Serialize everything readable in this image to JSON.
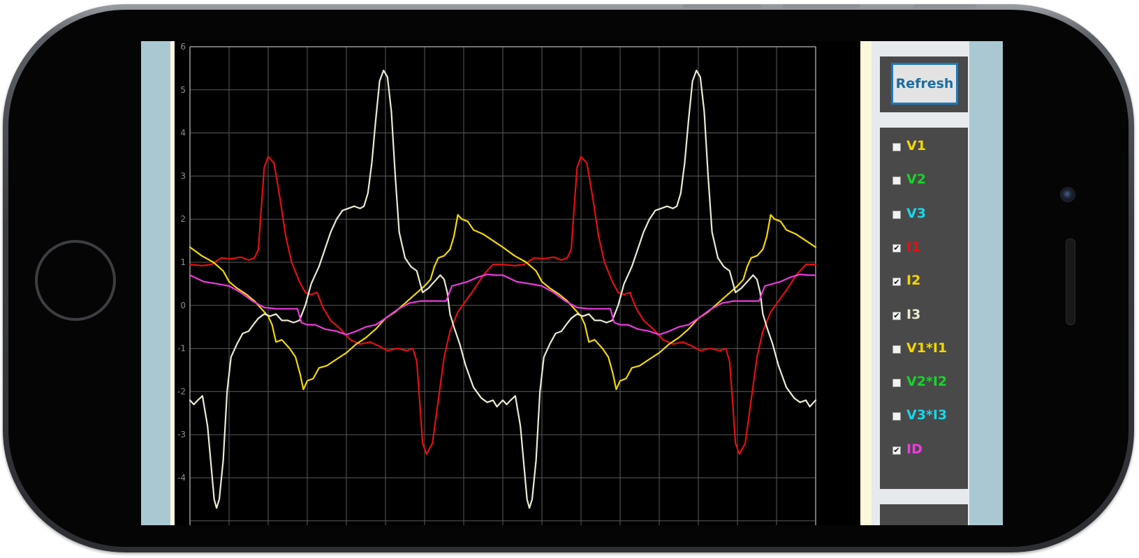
{
  "toolbar": {
    "refresh_label": "Refresh"
  },
  "series_toggles": [
    {
      "label": "V1",
      "checked": false,
      "color": "#f5d800"
    },
    {
      "label": "V2",
      "checked": false,
      "color": "#17d42a"
    },
    {
      "label": "V3",
      "checked": false,
      "color": "#1ad6e8"
    },
    {
      "label": "I1",
      "checked": true,
      "color": "#e51010"
    },
    {
      "label": "I2",
      "checked": true,
      "color": "#f5d800"
    },
    {
      "label": "I3",
      "checked": true,
      "color": "#ecebd2"
    },
    {
      "label": "V1*I1",
      "checked": false,
      "color": "#f5d800"
    },
    {
      "label": "V2*I2",
      "checked": false,
      "color": "#17d42a"
    },
    {
      "label": "V3*I3",
      "checked": false,
      "color": "#1ad6e8"
    },
    {
      "label": "ID",
      "checked": true,
      "color": "#ee3be0"
    }
  ],
  "lower_panel": {
    "partial_text": ""
  },
  "chart_data": {
    "type": "line",
    "title": "",
    "xlabel": "",
    "ylabel": "",
    "ylim": [
      -4.6,
      6
    ],
    "yticks": [
      6,
      5,
      4,
      3,
      2,
      1,
      0,
      -1,
      -2,
      -3,
      -4
    ],
    "grid": true,
    "x_divisions": 16,
    "series": [
      {
        "label_key": "I1",
        "color": "#e51010",
        "points": [
          [
            0.0,
            0.95
          ],
          [
            0.3,
            0.92
          ],
          [
            0.55,
            0.95
          ],
          [
            0.8,
            1.1
          ],
          [
            1.05,
            1.08
          ],
          [
            1.3,
            1.12
          ],
          [
            1.5,
            1.05
          ],
          [
            1.65,
            1.1
          ],
          [
            1.75,
            1.3
          ],
          [
            1.82,
            2.2
          ],
          [
            1.9,
            3.2
          ],
          [
            2.0,
            3.45
          ],
          [
            2.15,
            3.3
          ],
          [
            2.3,
            2.5
          ],
          [
            2.45,
            1.6
          ],
          [
            2.6,
            1.0
          ],
          [
            2.8,
            0.55
          ],
          [
            2.95,
            0.3
          ],
          [
            3.1,
            0.25
          ],
          [
            3.25,
            0.3
          ],
          [
            3.4,
            -0.05
          ],
          [
            3.6,
            -0.35
          ],
          [
            3.85,
            -0.55
          ],
          [
            4.1,
            -0.8
          ],
          [
            4.35,
            -0.9
          ],
          [
            4.6,
            -0.85
          ],
          [
            4.85,
            -0.95
          ],
          [
            5.05,
            -1.05
          ],
          [
            5.3,
            -1.0
          ],
          [
            5.55,
            -1.05
          ],
          [
            5.7,
            -1.0
          ],
          [
            5.8,
            -1.3
          ],
          [
            5.88,
            -2.3
          ],
          [
            5.95,
            -3.2
          ],
          [
            6.05,
            -3.45
          ],
          [
            6.2,
            -3.2
          ],
          [
            6.35,
            -2.2
          ],
          [
            6.5,
            -1.2
          ],
          [
            6.65,
            -0.6
          ],
          [
            6.85,
            -0.15
          ],
          [
            7.05,
            0.1
          ],
          [
            7.25,
            0.35
          ],
          [
            7.5,
            0.7
          ],
          [
            7.75,
            0.95
          ],
          [
            8.0,
            0.95
          ]
        ],
        "repeat_period": 8.0
      },
      {
        "label_key": "I2",
        "color": "#f5d800",
        "points": [
          [
            0.0,
            1.35
          ],
          [
            0.3,
            1.15
          ],
          [
            0.6,
            1.0
          ],
          [
            0.85,
            0.8
          ],
          [
            1.0,
            0.55
          ],
          [
            1.2,
            0.4
          ],
          [
            1.45,
            0.25
          ],
          [
            1.65,
            0.1
          ],
          [
            1.85,
            -0.1
          ],
          [
            2.0,
            -0.25
          ],
          [
            2.1,
            -0.45
          ],
          [
            2.2,
            -0.85
          ],
          [
            2.35,
            -0.8
          ],
          [
            2.55,
            -1.0
          ],
          [
            2.7,
            -1.2
          ],
          [
            2.82,
            -1.6
          ],
          [
            2.9,
            -1.95
          ],
          [
            3.0,
            -1.75
          ],
          [
            3.15,
            -1.7
          ],
          [
            3.3,
            -1.45
          ],
          [
            3.5,
            -1.4
          ],
          [
            3.75,
            -1.25
          ],
          [
            4.0,
            -1.1
          ],
          [
            4.25,
            -0.9
          ],
          [
            4.5,
            -0.75
          ],
          [
            4.75,
            -0.55
          ],
          [
            5.0,
            -0.3
          ],
          [
            5.25,
            -0.15
          ],
          [
            5.5,
            0.05
          ],
          [
            5.75,
            0.25
          ],
          [
            6.0,
            0.45
          ],
          [
            6.15,
            0.6
          ],
          [
            6.25,
            0.9
          ],
          [
            6.35,
            1.1
          ],
          [
            6.5,
            1.15
          ],
          [
            6.65,
            1.3
          ],
          [
            6.75,
            1.6
          ],
          [
            6.85,
            2.1
          ],
          [
            6.95,
            2.0
          ],
          [
            7.1,
            1.95
          ],
          [
            7.25,
            1.75
          ],
          [
            7.5,
            1.65
          ],
          [
            7.75,
            1.5
          ],
          [
            8.0,
            1.35
          ]
        ],
        "repeat_period": 8.0
      },
      {
        "label_key": "I3",
        "color": "#ecebd2",
        "points": [
          [
            0.0,
            -2.2
          ],
          [
            0.1,
            -2.3
          ],
          [
            0.2,
            -2.2
          ],
          [
            0.32,
            -2.1
          ],
          [
            0.45,
            -2.8
          ],
          [
            0.55,
            -3.8
          ],
          [
            0.62,
            -4.5
          ],
          [
            0.68,
            -4.7
          ],
          [
            0.75,
            -4.5
          ],
          [
            0.85,
            -3.6
          ],
          [
            0.95,
            -2.0
          ],
          [
            1.05,
            -1.2
          ],
          [
            1.2,
            -0.9
          ],
          [
            1.35,
            -0.65
          ],
          [
            1.5,
            -0.6
          ],
          [
            1.62,
            -0.45
          ],
          [
            1.75,
            -0.3
          ],
          [
            1.9,
            -0.2
          ],
          [
            2.05,
            -0.25
          ],
          [
            2.2,
            -0.2
          ],
          [
            2.35,
            -0.35
          ],
          [
            2.5,
            -0.35
          ],
          [
            2.65,
            -0.4
          ],
          [
            2.8,
            -0.35
          ],
          [
            2.95,
            0.0
          ],
          [
            3.1,
            0.5
          ],
          [
            3.3,
            0.9
          ],
          [
            3.45,
            1.3
          ],
          [
            3.6,
            1.7
          ],
          [
            3.75,
            2.0
          ],
          [
            3.9,
            2.2
          ],
          [
            4.05,
            2.25
          ],
          [
            4.2,
            2.3
          ],
          [
            4.35,
            2.25
          ],
          [
            4.45,
            2.3
          ],
          [
            4.55,
            2.6
          ],
          [
            4.65,
            3.3
          ],
          [
            4.75,
            4.3
          ],
          [
            4.85,
            5.2
          ],
          [
            4.95,
            5.45
          ],
          [
            5.05,
            5.3
          ],
          [
            5.15,
            4.5
          ],
          [
            5.25,
            3.0
          ],
          [
            5.35,
            1.7
          ],
          [
            5.5,
            1.1
          ],
          [
            5.65,
            0.9
          ],
          [
            5.8,
            0.8
          ],
          [
            5.95,
            0.3
          ],
          [
            6.1,
            0.4
          ],
          [
            6.25,
            0.55
          ],
          [
            6.4,
            0.7
          ],
          [
            6.5,
            0.6
          ],
          [
            6.58,
            0.3
          ],
          [
            6.65,
            -0.2
          ],
          [
            6.75,
            -0.5
          ],
          [
            6.9,
            -0.9
          ],
          [
            7.05,
            -1.4
          ],
          [
            7.25,
            -1.9
          ],
          [
            7.45,
            -2.15
          ],
          [
            7.6,
            -2.25
          ],
          [
            7.75,
            -2.2
          ],
          [
            7.85,
            -2.35
          ],
          [
            7.95,
            -2.25
          ],
          [
            8.0,
            -2.2
          ]
        ],
        "repeat_period": 8.0
      },
      {
        "label_key": "ID",
        "color": "#ee3be0",
        "points": [
          [
            0.0,
            0.7
          ],
          [
            0.35,
            0.55
          ],
          [
            0.7,
            0.5
          ],
          [
            1.0,
            0.45
          ],
          [
            1.3,
            0.3
          ],
          [
            1.6,
            0.1
          ],
          [
            1.9,
            -0.05
          ],
          [
            2.2,
            -0.08
          ],
          [
            2.5,
            -0.08
          ],
          [
            2.75,
            -0.08
          ],
          [
            2.85,
            -0.4
          ],
          [
            3.0,
            -0.45
          ],
          [
            3.2,
            -0.45
          ],
          [
            3.45,
            -0.55
          ],
          [
            3.75,
            -0.6
          ],
          [
            4.0,
            -0.68
          ],
          [
            4.25,
            -0.6
          ],
          [
            4.5,
            -0.5
          ],
          [
            4.75,
            -0.45
          ],
          [
            5.0,
            -0.3
          ],
          [
            5.3,
            -0.1
          ],
          [
            5.6,
            0.05
          ],
          [
            5.9,
            0.1
          ],
          [
            6.2,
            0.1
          ],
          [
            6.55,
            0.1
          ],
          [
            6.7,
            0.45
          ],
          [
            6.9,
            0.5
          ],
          [
            7.1,
            0.55
          ],
          [
            7.35,
            0.65
          ],
          [
            7.6,
            0.72
          ],
          [
            7.8,
            0.7
          ],
          [
            8.0,
            0.7
          ]
        ],
        "repeat_period": 8.0
      }
    ],
    "x_range_visible": [
      0,
      16
    ]
  }
}
